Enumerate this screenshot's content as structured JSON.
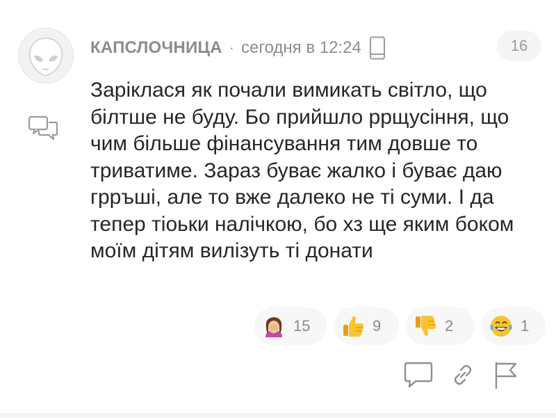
{
  "comment": {
    "author": "КАПСЛОЧНИЦА",
    "separator": "·",
    "time": "сегодня в 12:24",
    "rating": "16",
    "device_icon": "mobile-phone-icon",
    "avatar_icon": "alien-avatar-icon",
    "text": "Заріклася як почали вимикать світло, що білтше не буду. Бо прийшло ррщусіння, що чим більше фінансування тим довше то триватиме. Зараз буває жалко і буває даю грръші, але то вже далеко не ті суми. І да тепер тіоьки налічкою, бо хз ще яким боком моїм дітям вилізуть ті донати"
  },
  "reactions": [
    {
      "icon": "facepalm-emoji-icon",
      "count": "15"
    },
    {
      "icon": "thumbs-up-emoji-icon",
      "count": "9"
    },
    {
      "icon": "thumbs-down-emoji-icon",
      "count": "2"
    },
    {
      "icon": "laughing-tears-emoji-icon",
      "count": "1"
    }
  ],
  "actions": [
    "reply-icon",
    "link-icon",
    "flag-icon"
  ],
  "colors": {
    "accent_yellow": "#f6c433",
    "muted_text": "#8a8a8a",
    "pill_bg": "#f7f7f7"
  }
}
